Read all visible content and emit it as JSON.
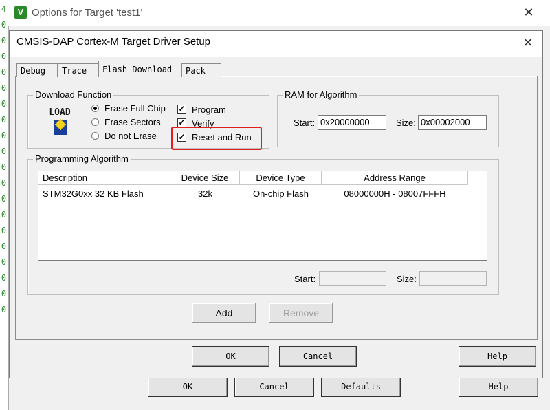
{
  "outer_dialog": {
    "title": "Options for Target 'test1'",
    "icon_letter": "V",
    "buttons": {
      "ok": "OK",
      "cancel": "Cancel",
      "defaults": "Defaults",
      "help": "Help"
    }
  },
  "inner_dialog": {
    "title": "CMSIS-DAP Cortex-M Target Driver Setup",
    "tabs": [
      {
        "label": "Debug",
        "active": false
      },
      {
        "label": "Trace",
        "active": false
      },
      {
        "label": "Flash Download",
        "active": true
      },
      {
        "label": "Pack",
        "active": false
      }
    ],
    "download_function": {
      "legend": "Download Function",
      "icon_text": "LOAD",
      "radios": [
        {
          "label": "Erase Full Chip",
          "checked": true
        },
        {
          "label": "Erase Sectors",
          "checked": false
        },
        {
          "label": "Do not Erase",
          "checked": false
        }
      ],
      "checks": [
        {
          "label": "Program",
          "checked": true
        },
        {
          "label": "Verify",
          "checked": true
        },
        {
          "label": "Reset and Run",
          "checked": true
        }
      ]
    },
    "ram_for_algorithm": {
      "legend": "RAM for Algorithm",
      "start_label": "Start:",
      "start_value": "0x20000000",
      "size_label": "Size:",
      "size_value": "0x00002000"
    },
    "programming_algorithm": {
      "legend": "Programming Algorithm",
      "columns": [
        "Description",
        "Device Size",
        "Device Type",
        "Address Range"
      ],
      "rows": [
        [
          "STM32G0xx 32 KB Flash",
          "32k",
          "On-chip Flash",
          "08000000H - 08007FFFH"
        ]
      ],
      "start_label": "Start:",
      "start_value": "",
      "size_label": "Size:",
      "size_value": ""
    },
    "buttons": {
      "add": "Add",
      "remove": "Remove",
      "ok": "OK",
      "cancel": "Cancel",
      "help": "Help"
    }
  },
  "gutter_chars": [
    "4",
    "0",
    "0",
    "0",
    "0",
    "0",
    "0",
    "0",
    "0",
    "0",
    "0",
    "0",
    "0",
    "0",
    "0",
    "0",
    "0",
    "0",
    "0",
    "0"
  ],
  "colors": {
    "highlight": "#e0201e",
    "keil_green": "#2a8a2a"
  }
}
